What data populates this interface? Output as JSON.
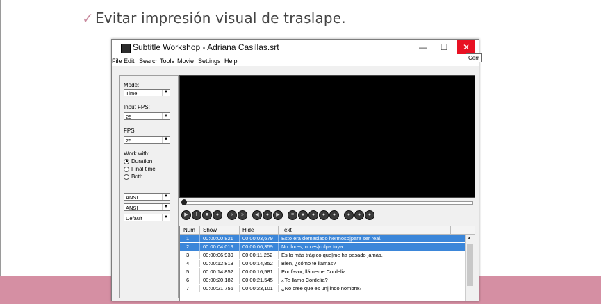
{
  "slide": {
    "bullet_check": "✓",
    "bullet_text": "Evitar impresión visual de traslape."
  },
  "window": {
    "title": "Subtitle Workshop - Adriana Casillas.srt",
    "minimize": "—",
    "maximize": "☐",
    "close": "✕",
    "tooltip": "Cerr"
  },
  "menu": [
    "File",
    "Edit",
    "Search",
    "Tools",
    "Movie",
    "Settings",
    "Help"
  ],
  "panel": {
    "mode_label": "Mode:",
    "mode_value": "Time",
    "input_fps_label": "Input FPS:",
    "input_fps_value": "25",
    "fps_label": "FPS:",
    "fps_value": "25",
    "work_with_label": "Work with:",
    "radio_options": [
      "Duration",
      "Final time",
      "Both"
    ],
    "radio_selected": "Duration",
    "charset1": "ANSI",
    "charset2": "ANSI",
    "charset3": "Default"
  },
  "table": {
    "headers": [
      "Num",
      "Show",
      "Hide",
      "Text"
    ],
    "rows": [
      {
        "num": "1",
        "show": "00:00:00,821",
        "hide": "00:00:03,679",
        "text": "Esto era demasiado hermoso|para ser real.",
        "selected": true
      },
      {
        "num": "2",
        "show": "00:00:04,019",
        "hide": "00:00:06,359",
        "text": "No llores, no es|culpa tuya.",
        "selected": true
      },
      {
        "num": "3",
        "show": "00:00:06,939",
        "hide": "00:00:11,252",
        "text": "Es lo más trágico que|me ha pasado jamás.",
        "selected": false
      },
      {
        "num": "4",
        "show": "00:00:12,813",
        "hide": "00:00:14,852",
        "text": "Bien, ¿cómo te llamas?",
        "selected": false
      },
      {
        "num": "5",
        "show": "00:00:14,852",
        "hide": "00:00:16,581",
        "text": "Por favor, llámeme Cordelia.",
        "selected": false
      },
      {
        "num": "6",
        "show": "00:00:20,182",
        "hide": "00:00:21,545",
        "text": "¿Te llamo Cordelia?",
        "selected": false
      },
      {
        "num": "7",
        "show": "00:00:21,756",
        "hide": "00:00:23,101",
        "text": "¿No cree que es un|lindo nombre?",
        "selected": false
      }
    ]
  },
  "colors": {
    "selection": "#3b86d9",
    "close_button": "#e81123",
    "band": "#d58fa3",
    "check": "#c98a9e"
  }
}
